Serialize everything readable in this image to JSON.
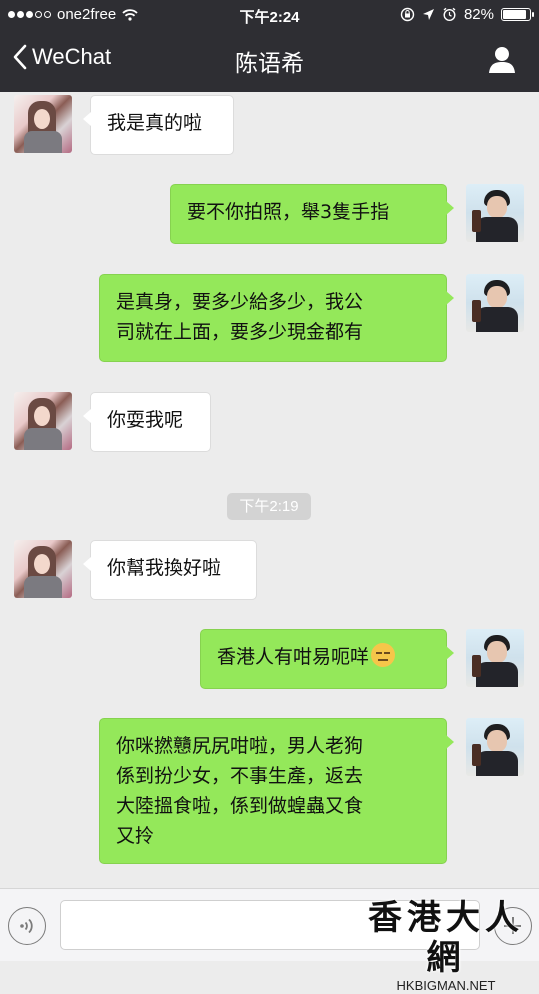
{
  "status_bar": {
    "carrier": "one2free",
    "time": "下午2:24",
    "battery": "82%",
    "battery_level": 0.82,
    "signal_dots": [
      true,
      true,
      true,
      false,
      false
    ]
  },
  "nav": {
    "back_label": "WeChat",
    "title": "陈语希",
    "back_icon": "chevron-left-icon",
    "profile_icon": "person-icon"
  },
  "messages": [
    {
      "side": "left",
      "text": "我是真的啦"
    },
    {
      "side": "right",
      "text": "要不你拍照，舉3隻手指"
    },
    {
      "side": "right",
      "lines": [
        "是真身，要多少給多少，我公",
        "司就在上面，要多少現金都有"
      ]
    },
    {
      "side": "left",
      "text": "你耍我呢"
    },
    {
      "side": "left",
      "text": "你幫我換好啦"
    },
    {
      "side": "right",
      "text": "香港人有咁易呃咩",
      "emoji": "expressionless-face-emoji"
    },
    {
      "side": "right",
      "lines": [
        "你咪撚戇尻尻咁啦，男人老狗",
        "係到扮少女，不事生產，返去",
        "大陸搵食啦，係到做蝗蟲又食",
        "又拎"
      ]
    }
  ],
  "timestamp": "下午2:19",
  "input_bar": {
    "voice_icon": "voice-icon",
    "plus_icon": "plus-icon"
  },
  "watermark": {
    "main": "香港大人網",
    "sub": "HKBIGMAN.NET"
  },
  "colors": {
    "header_bg": "#2e2e33",
    "chat_bg": "#ececec",
    "sent_bubble": "#94e85a",
    "received_bubble": "#ffffff"
  }
}
